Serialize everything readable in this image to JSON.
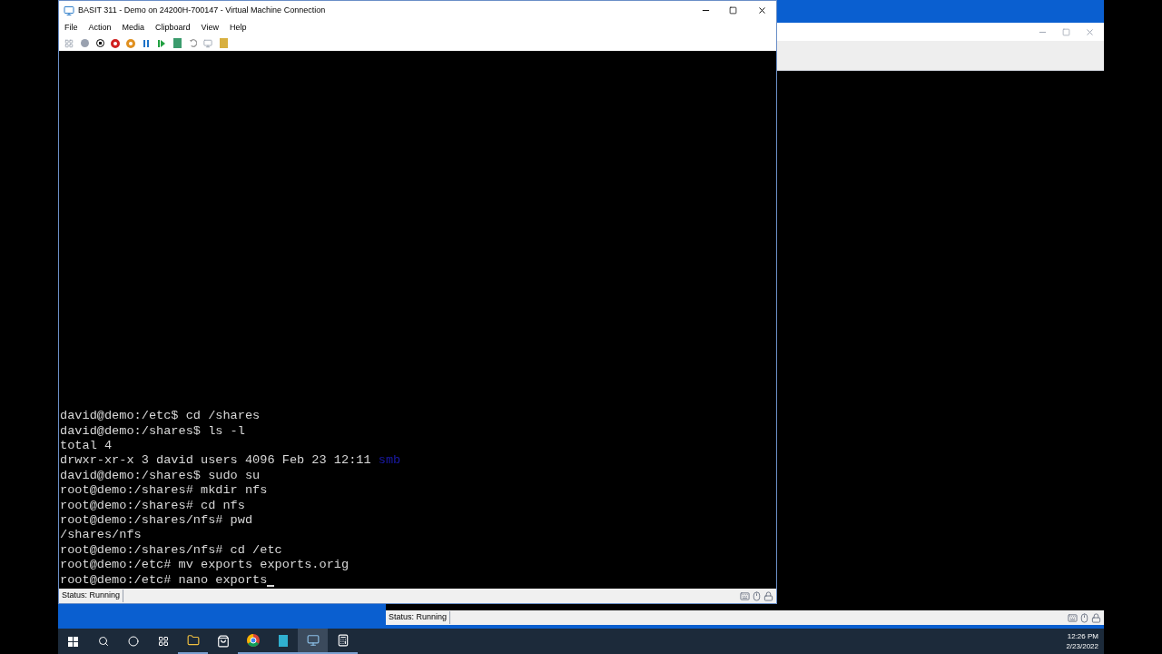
{
  "back_window": {
    "status": "Status: Running"
  },
  "window": {
    "title": "BASIT 311 - Demo on 24200H-700147 - Virtual Machine Connection",
    "menu": [
      "File",
      "Action",
      "Media",
      "Clipboard",
      "View",
      "Help"
    ],
    "terminal": [
      {
        "text": "david@demo:/etc$ cd /shares"
      },
      {
        "text": "david@demo:/shares$ ls -l"
      },
      {
        "text": "total 4"
      },
      {
        "text": "drwxr-xr-x 3 david users 4096 Feb 23 12:11 ",
        "dir": "smb"
      },
      {
        "text": "david@demo:/shares$ sudo su"
      },
      {
        "text": "root@demo:/shares# mkdir nfs"
      },
      {
        "text": "root@demo:/shares# cd nfs"
      },
      {
        "text": "root@demo:/shares/nfs# pwd"
      },
      {
        "text": "/shares/nfs"
      },
      {
        "text": "root@demo:/shares/nfs# cd /etc"
      },
      {
        "text": "root@demo:/etc# mv exports exports.orig"
      },
      {
        "text": "root@demo:/etc# nano exports",
        "cursor": true
      }
    ],
    "status": "Status: Running"
  },
  "taskbar": {
    "time": "12:26 PM",
    "date": "2/23/2022"
  }
}
